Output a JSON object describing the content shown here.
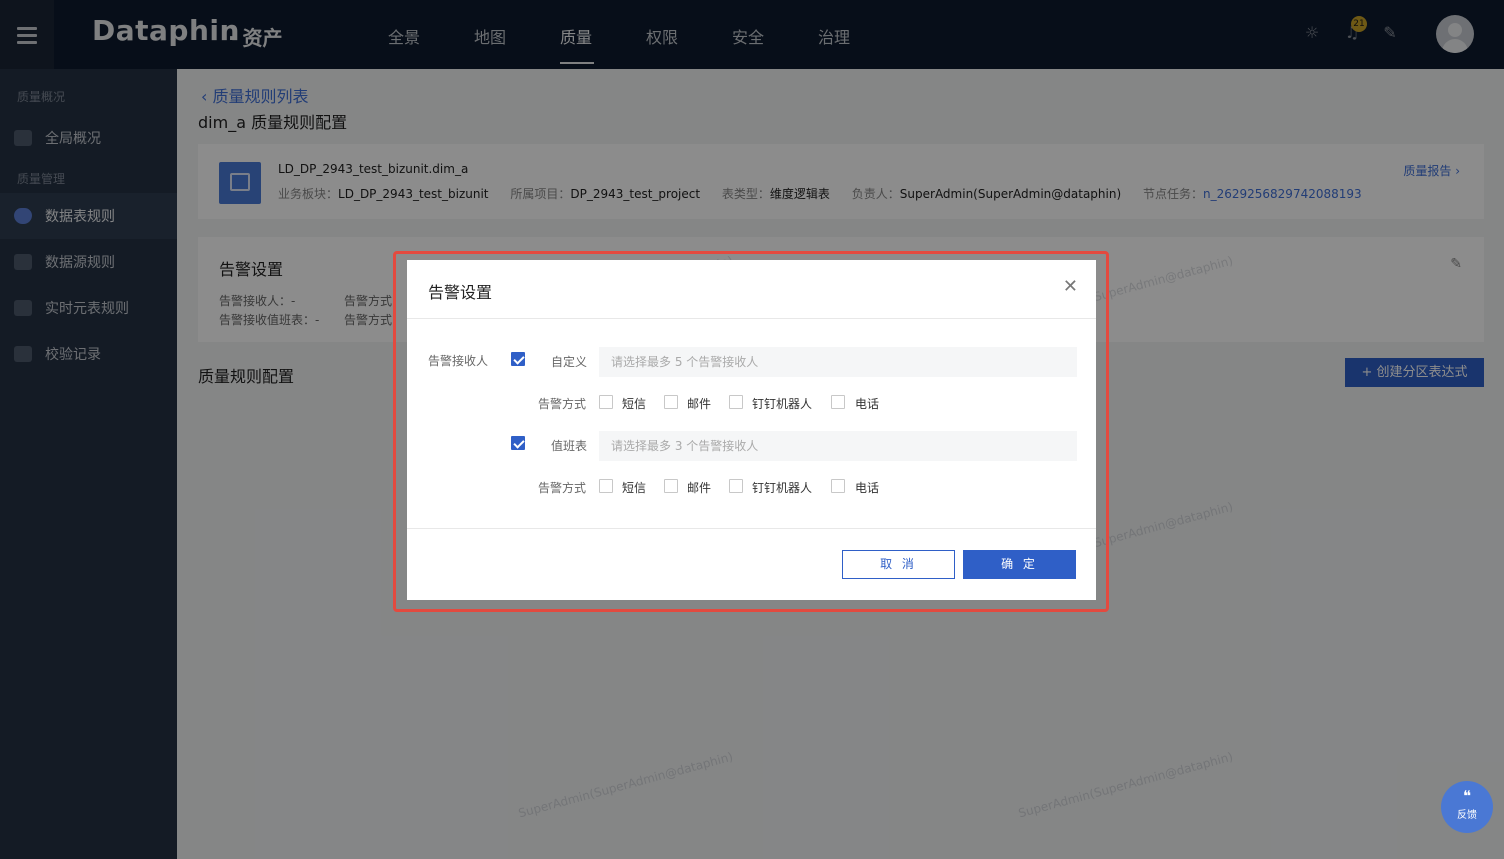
{
  "header": {
    "brand": "Dataphin",
    "brand_sub": "· 资产",
    "nav": [
      "全景",
      "地图",
      "质量",
      "权限",
      "安全",
      "治理"
    ],
    "active_nav": "质量",
    "notification_count": "21"
  },
  "sidebar": {
    "group1": "质量概况",
    "overview": "全局概况",
    "group2": "质量管理",
    "items": [
      "数据表规则",
      "数据源规则",
      "实时元表规则",
      "校验记录"
    ],
    "active_item": "数据表规则"
  },
  "page": {
    "back_link": "质量规则列表",
    "title": "dim_a 质量规则配置",
    "table_name": "LD_DP_2943_test_bizunit.dim_a",
    "meta": {
      "biz_label": "业务板块：",
      "biz_value": "LD_DP_2943_test_bizunit",
      "project_label": "所属项目：",
      "project_value": "DP_2943_test_project",
      "type_label": "表类型：",
      "type_value": "维度逻辑表",
      "owner_label": "负责人：",
      "owner_value": "SuperAdmin(SuperAdmin@dataphin)",
      "task_label": "节点任务：",
      "task_value": "n_2629256829742088193"
    },
    "report_link": "质量报告",
    "alert_card": {
      "title": "告警设置",
      "receiver": "告警接收人：-",
      "receiver_method": "告警方式",
      "duty": "告警接收值班表：-",
      "duty_method": "告警方式"
    },
    "rules_title": "质量规则配置",
    "create_button": "+ 创建分区表达式",
    "feedback": "反馈",
    "watermark": "SuperAdmin(SuperAdmin@dataphin)"
  },
  "modal": {
    "title": "告警设置",
    "receiver_label": "告警接收人",
    "custom": {
      "checked": true,
      "label": "自定义",
      "placeholder": "请选择最多 5 个告警接收人",
      "method_label": "告警方式",
      "methods": [
        "短信",
        "邮件",
        "钉钉机器人",
        "电话"
      ]
    },
    "duty": {
      "checked": true,
      "label": "值班表",
      "placeholder": "请选择最多 3 个告警接收人",
      "method_label": "告警方式",
      "methods": [
        "短信",
        "邮件",
        "钉钉机器人",
        "电话"
      ]
    },
    "cancel": "取 消",
    "ok": "确 定"
  },
  "colors": {
    "primary": "#2f5fc7",
    "highlight": "#e34a3f",
    "topbar": "#0d1a2e",
    "sidebar": "#253244"
  }
}
